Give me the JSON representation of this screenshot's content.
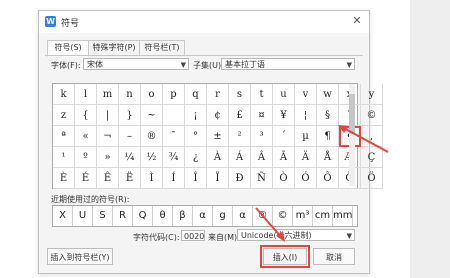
{
  "window": {
    "title": "符号",
    "app_icon_glyph": "W"
  },
  "tabs": [
    "符号(S)",
    "特殊字符(P)",
    "符号栏(T)"
  ],
  "font_label": "字体(F):",
  "font_value": "宋体",
  "subset_label": "子集(U):",
  "subset_value": "基本拉丁语",
  "grid": [
    [
      "k",
      "l",
      "m",
      "n",
      "o",
      "p",
      "q",
      "r",
      "s",
      "t",
      "u",
      "v",
      "w",
      "x",
      "y"
    ],
    [
      "z",
      "{",
      "|",
      "}",
      "~",
      "",
      "¡",
      "¢",
      "£",
      "¤",
      "¥",
      "¦",
      "§",
      "¨",
      "©"
    ],
    [
      "ª",
      "«",
      "¬",
      "–",
      "®",
      "¯",
      "°",
      "±",
      "²",
      "³",
      "´",
      "µ",
      "¶",
      "•",
      ","
    ],
    [
      "¹",
      "º",
      "»",
      "¼",
      "½",
      "¾",
      "¿",
      "À",
      "Á",
      "Â",
      "Ã",
      "Ä",
      "Å",
      "Æ",
      "Ç"
    ],
    [
      "È",
      "É",
      "Ê",
      "Ë",
      "Ì",
      "Í",
      "Î",
      "Ï",
      "Ð",
      "Ñ",
      "Ò",
      "Ó",
      "Ô",
      "Õ",
      "Ö"
    ]
  ],
  "selected_symbol": "•",
  "recent_label": "近期使用过的符号(R):",
  "recent": [
    "X",
    "U",
    "S",
    "R",
    "Q",
    "θ",
    "β",
    "α",
    "g",
    "α",
    "®",
    "©",
    "m³",
    "cm",
    "mm"
  ],
  "char_code_label": "字符代码(C):",
  "char_code_value": "0020",
  "from_label": "来自(M)",
  "from_value": "Unicode(十六进制)",
  "insert_to_bar_button": "插入到符号栏(Y)",
  "insert_button": "插入(I)",
  "cancel_button": "取消",
  "accent_color": "#e2463f"
}
